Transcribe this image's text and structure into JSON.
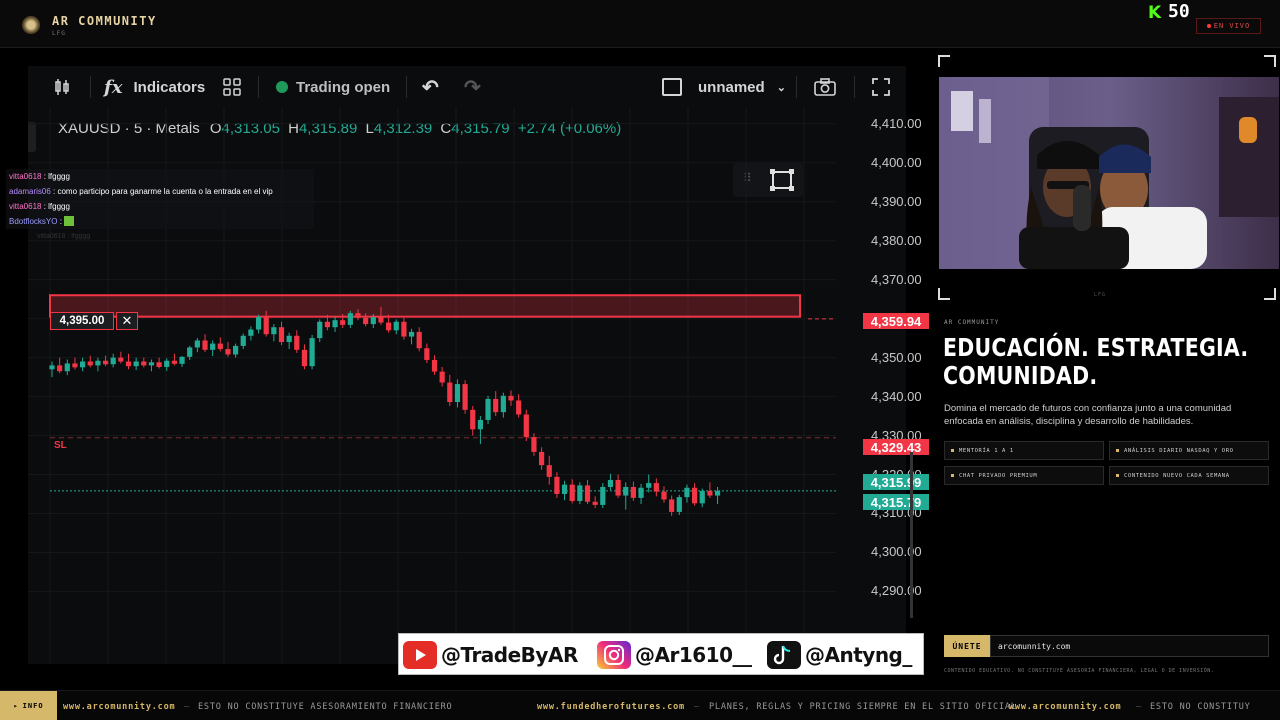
{
  "header": {
    "brand_name": "AR COMMUNITY",
    "brand_sub": "LFG",
    "kick_count": "50",
    "live_label": "EN VIVO"
  },
  "toolbar": {
    "indicators_label": "Indicators",
    "trading_status": "Trading open",
    "layout_name": "unnamed"
  },
  "symbol": {
    "title": "XAUUSD · 5 · Metals",
    "open_key": "O",
    "open": "4,313.05",
    "high_key": "H",
    "high": "4,315.89",
    "low_key": "L",
    "low": "4,312.39",
    "close_key": "C",
    "close": "4,315.79",
    "change": "+2.74 (+0.06%)"
  },
  "price_scale": [
    "4,410.00",
    "4,400.00",
    "4,390.00",
    "4,380.00",
    "4,370.00",
    "4,360.00",
    "4,350.00",
    "4,340.00",
    "4,330.00",
    "4,320.00",
    "4,310.00",
    "4,300.00",
    "4,290.00"
  ],
  "price_tags": {
    "alert_price": "4,395.00",
    "target": "4,359.94",
    "stop": "4,329.43",
    "ask": "4,315.99",
    "last": "4,315.79"
  },
  "chart_labels": {
    "sl": "SL"
  },
  "chart_data": {
    "type": "candlestick",
    "symbol": "XAUUSD",
    "interval": "5",
    "ylim": [
      4286,
      4412
    ],
    "candles": [
      [
        4347.0,
        4349.0,
        4345.0,
        4348.0
      ],
      [
        4348.0,
        4350.0,
        4346.0,
        4346.5
      ],
      [
        4346.5,
        4349.5,
        4345.5,
        4348.5
      ],
      [
        4348.5,
        4350.0,
        4347.0,
        4347.5
      ],
      [
        4347.5,
        4350.0,
        4346.5,
        4349.0
      ],
      [
        4349.0,
        4350.5,
        4347.5,
        4348.0
      ],
      [
        4348.0,
        4350.0,
        4346.5,
        4349.2
      ],
      [
        4349.2,
        4350.5,
        4347.8,
        4348.3
      ],
      [
        4348.3,
        4351.0,
        4347.5,
        4350.0
      ],
      [
        4350.0,
        4351.5,
        4348.5,
        4349.0
      ],
      [
        4349.0,
        4351.0,
        4347.0,
        4347.8
      ],
      [
        4347.8,
        4350.0,
        4346.8,
        4349.0
      ],
      [
        4349.0,
        4350.0,
        4347.5,
        4348.0
      ],
      [
        4348.0,
        4349.5,
        4346.5,
        4348.8
      ],
      [
        4348.8,
        4350.0,
        4347.2,
        4347.6
      ],
      [
        4347.6,
        4349.8,
        4346.6,
        4349.2
      ],
      [
        4349.2,
        4351.0,
        4348.0,
        4348.4
      ],
      [
        4348.4,
        4350.4,
        4347.6,
        4350.2
      ],
      [
        4350.2,
        4353.0,
        4349.4,
        4352.6
      ],
      [
        4352.6,
        4355.0,
        4351.4,
        4354.4
      ],
      [
        4354.4,
        4356.0,
        4351.4,
        4352.0
      ],
      [
        4352.0,
        4354.4,
        4350.4,
        4353.6
      ],
      [
        4353.6,
        4355.2,
        4351.6,
        4352.2
      ],
      [
        4352.2,
        4354.0,
        4350.2,
        4350.8
      ],
      [
        4350.8,
        4353.6,
        4350.0,
        4353.0
      ],
      [
        4353.0,
        4356.2,
        4352.2,
        4355.6
      ],
      [
        4355.6,
        4358.0,
        4354.4,
        4357.2
      ],
      [
        4357.2,
        4361.0,
        4356.2,
        4360.4
      ],
      [
        4360.4,
        4362.0,
        4355.4,
        4356.0
      ],
      [
        4356.0,
        4358.6,
        4354.2,
        4357.8
      ],
      [
        4357.8,
        4359.2,
        4353.2,
        4354.0
      ],
      [
        4354.0,
        4356.4,
        4352.2,
        4355.6
      ],
      [
        4355.6,
        4357.0,
        4351.2,
        4352.0
      ],
      [
        4352.0,
        4353.4,
        4347.0,
        4347.8
      ],
      [
        4347.8,
        4355.8,
        4347.0,
        4355.0
      ],
      [
        4355.0,
        4359.8,
        4354.0,
        4359.2
      ],
      [
        4359.2,
        4361.0,
        4357.0,
        4357.8
      ],
      [
        4357.8,
        4360.4,
        4356.6,
        4359.6
      ],
      [
        4359.6,
        4361.2,
        4357.6,
        4358.4
      ],
      [
        4358.4,
        4362.0,
        4357.6,
        4361.4
      ],
      [
        4361.4,
        4362.4,
        4359.6,
        4360.2
      ],
      [
        4360.2,
        4361.4,
        4358.0,
        4358.6
      ],
      [
        4358.6,
        4361.2,
        4357.6,
        4360.4
      ],
      [
        4360.4,
        4363.0,
        4358.4,
        4359.0
      ],
      [
        4359.0,
        4361.0,
        4356.4,
        4357.0
      ],
      [
        4357.0,
        4359.8,
        4356.0,
        4359.2
      ],
      [
        4359.2,
        4360.2,
        4354.6,
        4355.4
      ],
      [
        4355.4,
        4357.4,
        4353.4,
        4356.6
      ],
      [
        4356.6,
        4357.8,
        4351.6,
        4352.4
      ],
      [
        4352.4,
        4353.6,
        4348.6,
        4349.4
      ],
      [
        4349.4,
        4350.6,
        4345.6,
        4346.4
      ],
      [
        4346.4,
        4347.6,
        4342.6,
        4343.6
      ],
      [
        4343.6,
        4345.6,
        4337.6,
        4338.6
      ],
      [
        4338.6,
        4344.4,
        4337.2,
        4343.2
      ],
      [
        4343.2,
        4344.2,
        4335.6,
        4336.6
      ],
      [
        4336.6,
        4337.6,
        4330.0,
        4331.6
      ],
      [
        4331.6,
        4335.0,
        4327.8,
        4334.0
      ],
      [
        4334.0,
        4340.2,
        4333.0,
        4339.4
      ],
      [
        4339.4,
        4341.4,
        4335.0,
        4336.0
      ],
      [
        4336.0,
        4341.0,
        4334.6,
        4340.2
      ],
      [
        4340.2,
        4341.6,
        4337.6,
        4339.0
      ],
      [
        4339.0,
        4340.6,
        4334.6,
        4335.4
      ],
      [
        4335.4,
        4336.6,
        4328.6,
        4329.6
      ],
      [
        4329.6,
        4330.6,
        4324.8,
        4325.8
      ],
      [
        4325.8,
        4327.0,
        4321.2,
        4322.4
      ],
      [
        4322.4,
        4324.8,
        4317.4,
        4319.4
      ],
      [
        4319.4,
        4320.6,
        4314.0,
        4315.0
      ],
      [
        4315.0,
        4318.4,
        4313.4,
        4317.4
      ],
      [
        4317.4,
        4318.8,
        4312.6,
        4313.2
      ],
      [
        4313.2,
        4318.0,
        4312.4,
        4317.2
      ],
      [
        4317.2,
        4318.6,
        4312.4,
        4313.0
      ],
      [
        4313.0,
        4314.4,
        4311.4,
        4312.2
      ],
      [
        4312.2,
        4317.8,
        4311.4,
        4316.8
      ],
      [
        4316.8,
        4320.2,
        4316.0,
        4318.6
      ],
      [
        4318.6,
        4320.0,
        4314.0,
        4314.6
      ],
      [
        4314.6,
        4318.0,
        4311.0,
        4316.8
      ],
      [
        4316.8,
        4318.2,
        4313.2,
        4314.0
      ],
      [
        4314.0,
        4317.6,
        4312.4,
        4316.6
      ],
      [
        4316.6,
        4320.0,
        4315.4,
        4317.8
      ],
      [
        4317.8,
        4319.0,
        4314.4,
        4315.6
      ],
      [
        4315.6,
        4317.0,
        4312.8,
        4313.6
      ],
      [
        4313.6,
        4314.6,
        4309.4,
        4310.4
      ],
      [
        4310.4,
        4314.8,
        4309.6,
        4314.2
      ],
      [
        4314.2,
        4317.4,
        4312.8,
        4316.6
      ],
      [
        4316.6,
        4317.8,
        4312.0,
        4312.6
      ],
      [
        4312.6,
        4316.4,
        4311.6,
        4315.8
      ],
      [
        4315.8,
        4318.0,
        4314.0,
        4314.6
      ],
      [
        4314.6,
        4316.8,
        4312.4,
        4315.8
      ]
    ],
    "levels": {
      "target_zone": [
        4360.5,
        4366.0
      ],
      "tp": 4359.94,
      "sl": 4329.43,
      "last": 4315.79
    },
    "colors": {
      "up": "#22ab94",
      "down": "#f23645",
      "zone": "#f23645"
    }
  },
  "chat": [
    {
      "user": "vitta0618",
      "color": "u1",
      "msg": "lfgggg"
    },
    {
      "user": "adamaris06",
      "color": "u2",
      "msg": "como participo para ganarme la cuenta o la entrada en el vip"
    },
    {
      "user": "vitta0618",
      "color": "u1",
      "msg": "lfgggg"
    },
    {
      "user": "BdotflocksYO",
      "color": "u3",
      "msg": ""
    }
  ],
  "chat_faded": "vitta0618 : lfgggg",
  "cam_lfg": "LFG",
  "panel": {
    "sub": "AR COMMUNITY",
    "headline_1": "EDUCACIÓN. ESTRATEGIA.",
    "headline_2": "COMUNIDAD.",
    "description": "Domina el mercado de futuros con confianza junto a una comunidad enfocada en análisis, disciplina y desarrollo de habilidades.",
    "features": [
      "MENTORÍA 1 A 1",
      "ANÁLISIS DIARIO NASDAQ Y ORO",
      "CHAT PRIVADO PREMIUM",
      "CONTENIDO NUEVO CADA SEMANA"
    ],
    "join_label": "ÚNETE",
    "join_url": "arcomunnity.com",
    "disclaimer": "CONTENIDO EDUCATIVO. NO CONSTITUYE ASESORÍA FINANCIERA, LEGAL O DE INVERSIÓN."
  },
  "socials": {
    "youtube": "@TradeByAR",
    "instagram": "@Ar1610__",
    "tiktok": "@Antyng_"
  },
  "ticker": {
    "info_label": "INFO",
    "items": [
      "www.arcomunnity.com",
      "ESTO NO CONSTITUYE ASESORAMIENTO FINANCIERO",
      "www.fundedherofutures.com",
      "PLANES, REGLAS Y PRICING SIEMPRE EN EL SITIO OFICIAL",
      "www.arcomunnity.com",
      "ESTO NO CONSTITUY"
    ]
  }
}
